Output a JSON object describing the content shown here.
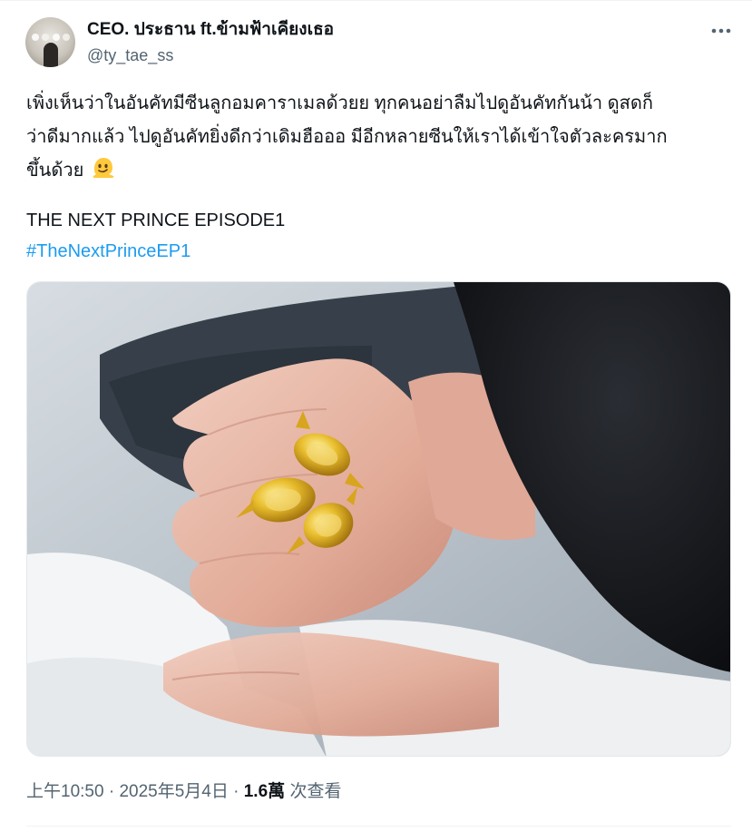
{
  "author": {
    "display_name": "CEO. ประธาน ft.ข้ามฟ้าเคียงเธอ",
    "handle": "@ty_tae_ss"
  },
  "tweet": {
    "text_line1": "เพิ่งเห็นว่าในอันคัทมีซีนลูกอมคาราเมลด้วยย ทุกคนอย่าลืมไปดูอันคัทกันน้า ดูสดก็",
    "text_line2": "ว่าดีมากแล้ว ไปดูอันคัทยิ่งดีกว่าเดิมฮือออ มีอีกหลายซีนให้เราได้เข้าใจตัวละครมาก",
    "text_line3": "ขึ้นด้วย",
    "emoji": "melting-face-emoji",
    "episode_title": "THE NEXT PRINCE EPISODE1",
    "hashtag": "#TheNextPrinceEP1"
  },
  "meta": {
    "time": "上午10:50",
    "separator": " · ",
    "date": "2025年5月4日",
    "views_count": "1.6萬",
    "views_label": "次查看"
  },
  "icons": {
    "more": "more-horizontal-icon"
  },
  "colors": {
    "link": "#1d9bf0",
    "secondary_text": "#536471",
    "primary_text": "#0f1419",
    "candy_gold": "#e2b322"
  }
}
